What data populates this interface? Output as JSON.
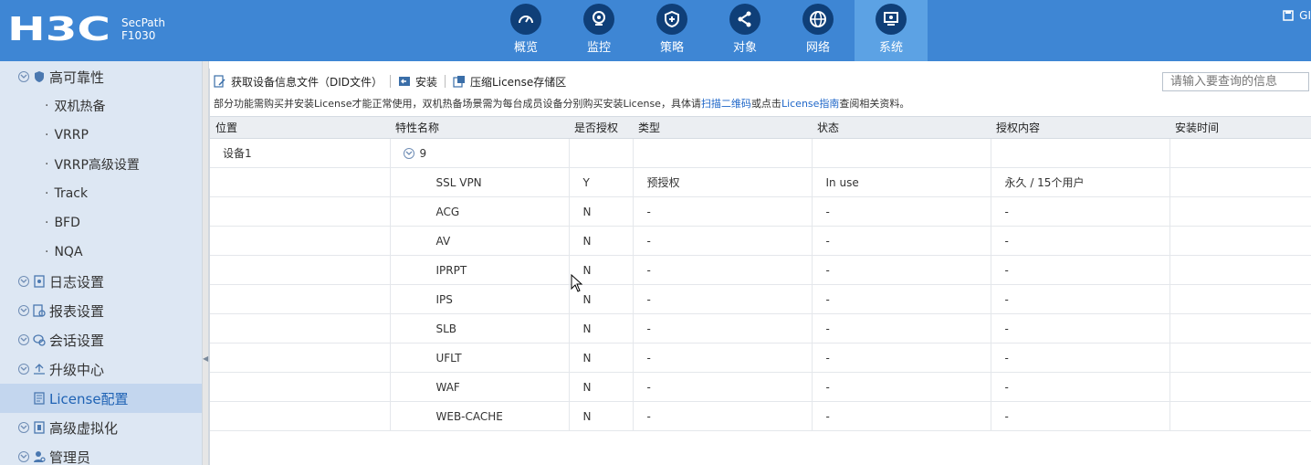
{
  "header": {
    "logo_text": "H3C",
    "product_line1": "SecPath",
    "product_line2": "F1030",
    "right_text": "GI",
    "nav": [
      {
        "label": "概览",
        "icon": "speedometer-icon",
        "active": false
      },
      {
        "label": "监控",
        "icon": "camera-icon",
        "active": false
      },
      {
        "label": "策略",
        "icon": "shield-plus-icon",
        "active": false
      },
      {
        "label": "对象",
        "icon": "share-nodes-icon",
        "active": false
      },
      {
        "label": "网络",
        "icon": "globe-icon",
        "active": false
      },
      {
        "label": "系统",
        "icon": "monitor-icon",
        "active": true
      }
    ]
  },
  "sidebar": {
    "items": [
      {
        "label": "高可靠性",
        "type": "group",
        "icon": "shield-icon"
      },
      {
        "label": "双机热备",
        "type": "sub"
      },
      {
        "label": "VRRP",
        "type": "sub"
      },
      {
        "label": "VRRP高级设置",
        "type": "sub"
      },
      {
        "label": "Track",
        "type": "sub"
      },
      {
        "label": "BFD",
        "type": "sub"
      },
      {
        "label": "NQA",
        "type": "sub"
      },
      {
        "label": "日志设置",
        "type": "group",
        "icon": "log-icon"
      },
      {
        "label": "报表设置",
        "type": "group",
        "icon": "report-icon"
      },
      {
        "label": "会话设置",
        "type": "group",
        "icon": "session-icon"
      },
      {
        "label": "升级中心",
        "type": "group",
        "icon": "upload-icon"
      },
      {
        "label": "License配置",
        "type": "selected",
        "icon": "license-icon"
      },
      {
        "label": "高级虚拟化",
        "type": "group",
        "icon": "virtual-icon"
      },
      {
        "label": "管理员",
        "type": "group",
        "icon": "admin-icon"
      }
    ]
  },
  "toolbar": {
    "get_did": "获取设备信息文件（DID文件）",
    "install": "安装",
    "compress": "压缩License存储区",
    "search_placeholder": "请输入要查询的信息"
  },
  "notice": {
    "prefix": "部分功能需购买并安装License才能正常使用，双机热备场景需为每台成员设备分别购买安装License，具体请",
    "link1": "扫描二维码",
    "middle": "或点击",
    "link2": "License指南",
    "suffix": "查阅相关资料。"
  },
  "table": {
    "headers": [
      "位置",
      "特性名称",
      "是否授权",
      "类型",
      "状态",
      "授权内容",
      "安装时间"
    ],
    "group": {
      "position": "设备1",
      "count": "9"
    },
    "rows": [
      {
        "name": "SSL VPN",
        "auth": "Y",
        "type": "预授权",
        "state": "In use",
        "content": "永久 / 15个用户",
        "time": ""
      },
      {
        "name": "ACG",
        "auth": "N",
        "type": "-",
        "state": "-",
        "content": "-",
        "time": ""
      },
      {
        "name": "AV",
        "auth": "N",
        "type": "-",
        "state": "-",
        "content": "-",
        "time": ""
      },
      {
        "name": "IPRPT",
        "auth": "N",
        "type": "-",
        "state": "-",
        "content": "-",
        "time": ""
      },
      {
        "name": "IPS",
        "auth": "N",
        "type": "-",
        "state": "-",
        "content": "-",
        "time": ""
      },
      {
        "name": "SLB",
        "auth": "N",
        "type": "-",
        "state": "-",
        "content": "-",
        "time": ""
      },
      {
        "name": "UFLT",
        "auth": "N",
        "type": "-",
        "state": "-",
        "content": "-",
        "time": ""
      },
      {
        "name": "WAF",
        "auth": "N",
        "type": "-",
        "state": "-",
        "content": "-",
        "time": ""
      },
      {
        "name": "WEB-CACHE",
        "auth": "N",
        "type": "-",
        "state": "-",
        "content": "-",
        "time": ""
      }
    ]
  }
}
